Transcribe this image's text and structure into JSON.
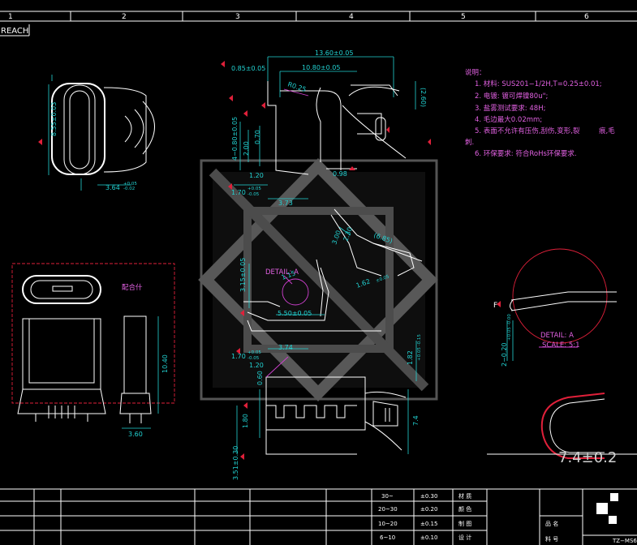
{
  "frame": {
    "columns": [
      "1",
      "2",
      "3",
      "4",
      "5",
      "6"
    ],
    "reach_label": "REACH"
  },
  "dims": {
    "top_width": "13.60±0.05",
    "top_inner": "10.80±0.05",
    "top_085": "0.85±0.05",
    "r025": "R0.25",
    "d260": "(2.60)",
    "v4080": "4−0.80±0.05",
    "v200": "2.00",
    "v070": "0.70",
    "h120a": "1.20",
    "h098": "0.98",
    "h170a": "1.70",
    "tol_up": "+0.05",
    "tol_dn": "-0.05",
    "h373": "3.73",
    "side_855": "8.55±0.03",
    "side_364": "3.64",
    "side_364_tol_up": "+0.05",
    "side_364_tol_dn": "-0.02",
    "d300": "3.00",
    "d230": "2.30",
    "d685": "(6.85)",
    "d315": "3.15±0.05",
    "d115": "1.15",
    "detail_a": "DETAIL: A",
    "d162": "1.62",
    "d162_tol": "±0.05",
    "d550": "5.50±0.05",
    "d374": "3.74",
    "h170b": "1.70",
    "h120b": "1.20",
    "v060": "0.60",
    "v180": "1.80",
    "v74": "7.4",
    "d351": "3.51±0.30",
    "d182": "1.82",
    "d182_tol": "+0.05 -0.15",
    "v1040": "10.40",
    "h360": "3.60",
    "mating_label": "配合什",
    "detail_label": "DETAIL: A",
    "scale_label": "SCALE: 5:1",
    "d020": "2−0.20",
    "d020_tol": "+0.05 -0.00",
    "big_dim": "7.4±0.2"
  },
  "notes": {
    "title": "说明：",
    "lines": [
      "1. 材料: SUS201−1/2H,T=0.25±0.01;",
      "2. 电镀: 镀可焊镍80u\";",
      "3. 盐雾测试要求: 48H;",
      "4. 毛边最大0.02mm;",
      "5. 表面不允许有压伤,刮伤,变形,裂",
      "6. 环保要求: 符合RoHs环保要求."
    ],
    "line5_tail": "痕,毛",
    "line5_wrap": "刺."
  },
  "title_block": {
    "tol_ranges": [
      "30~",
      "20~30",
      "10~20",
      "6~10"
    ],
    "tol_values": [
      "±0.30",
      "±0.20",
      "±0.15",
      "±0.10"
    ],
    "labels": [
      "材 质",
      "颜 色",
      "制 图",
      "设 计"
    ],
    "right_labels": [
      "品 名",
      "料 号"
    ],
    "company": "TZ−MS6"
  },
  "colors": {
    "background": "#000000",
    "outline": "#ffffff",
    "dimension": "#22d3d3",
    "annotation": "#e0203a",
    "notes": "#e060e0"
  }
}
